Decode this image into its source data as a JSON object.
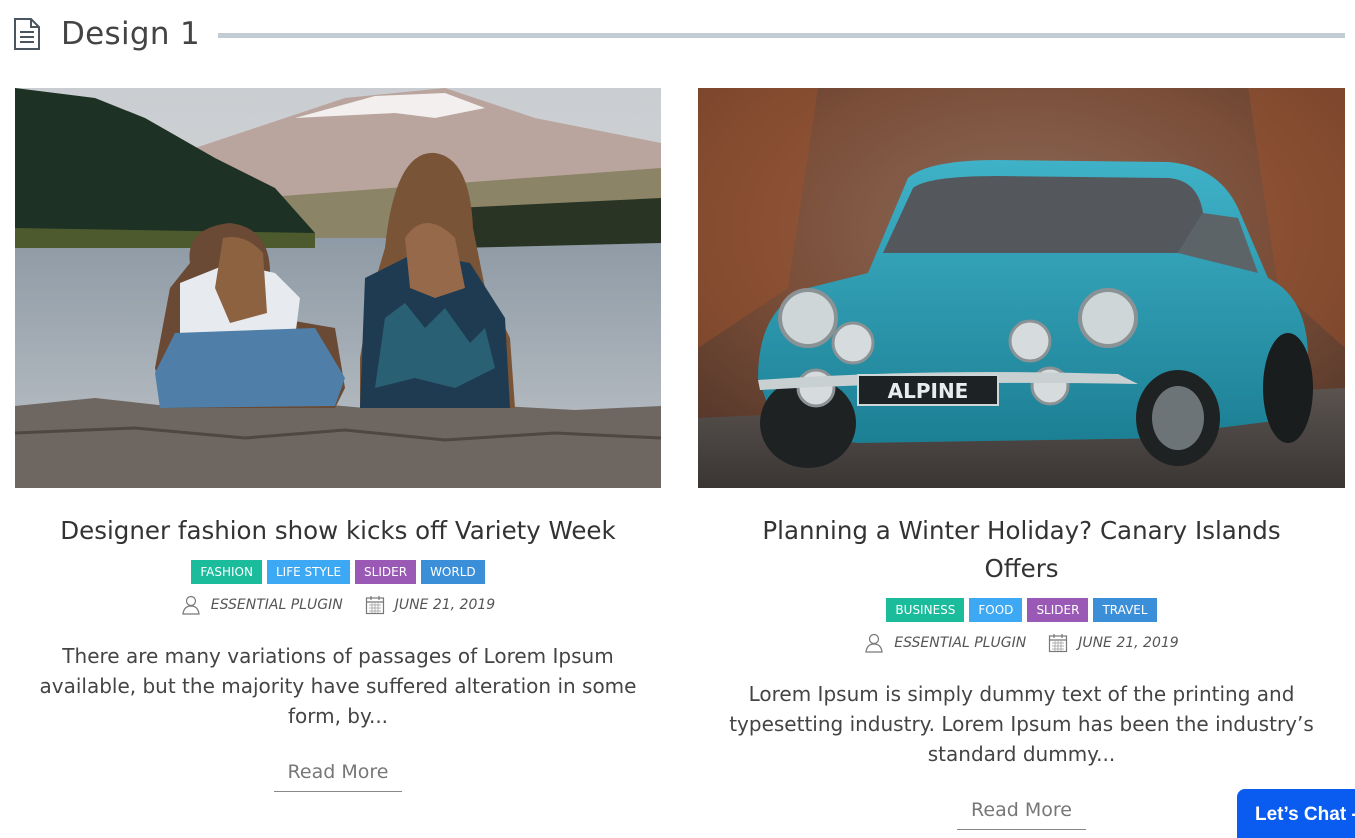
{
  "section": {
    "title": "Design 1",
    "icon": "document-icon"
  },
  "posts": [
    {
      "image_alt": "two-girls-by-lake",
      "title": "Designer fashion show kicks off Variety Week",
      "tags": [
        {
          "label": "FASHION",
          "color": "#1abc9c"
        },
        {
          "label": "LIFE STYLE",
          "color": "#3da9f5"
        },
        {
          "label": "SLIDER",
          "color": "#9b59b6"
        },
        {
          "label": "WORLD",
          "color": "#3b8fd9"
        }
      ],
      "author": "ESSENTIAL PLUGIN",
      "date": "JUNE 21, 2019",
      "excerpt": "There are many variations of passages of Lorem Ipsum available, but the majority have suffered alteration in some form, by...",
      "read_more": "Read More"
    },
    {
      "image_alt": "blue-alpine-car",
      "title": "Planning a Winter Holiday? Canary Islands Offers",
      "tags": [
        {
          "label": "BUSINESS",
          "color": "#1abc9c"
        },
        {
          "label": "FOOD",
          "color": "#3da9f5"
        },
        {
          "label": "SLIDER",
          "color": "#9b59b6"
        },
        {
          "label": "TRAVEL",
          "color": "#3b8fd9"
        }
      ],
      "author": "ESSENTIAL PLUGIN",
      "date": "JUNE 21, 2019",
      "excerpt": "Lorem Ipsum is simply dummy text of the printing and typesetting industry. Lorem Ipsum has been the industry’s standard dummy...",
      "read_more": "Read More",
      "plate_text": "ALPINE"
    }
  ],
  "chat": {
    "label": "Let’s Chat -",
    "color": "#0a5cf0"
  }
}
